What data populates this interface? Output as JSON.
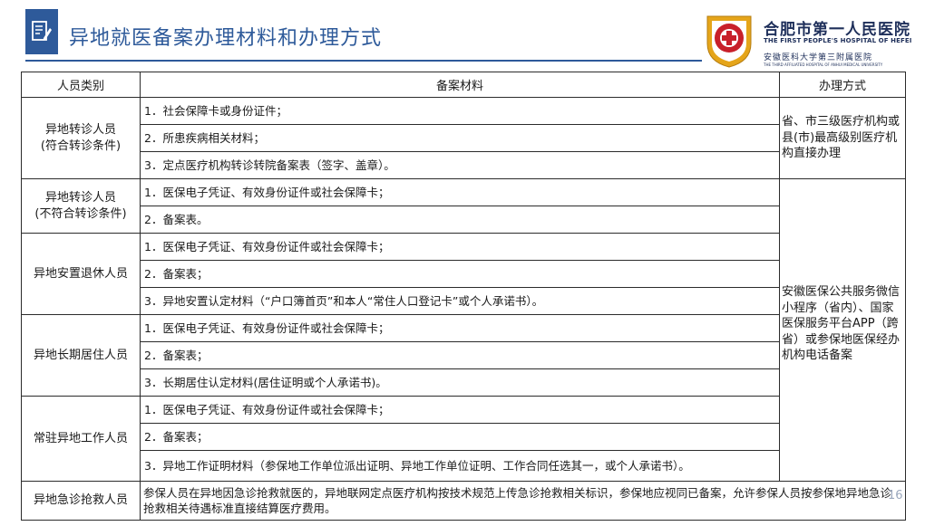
{
  "header": {
    "title": "异地就医备案办理材料和办理方式",
    "hospital_cn": "合肥市第一人民医院",
    "hospital_en": "THE FIRST PEOPLE'S HOSPITAL OF HEFEI",
    "hospital_sub_cn": "安徽医科大学第三附属医院",
    "hospital_sub_en": "THE THIRD AFFILIATED HOSPITAL OF ANHUI MEDICAL UNIVERSITY",
    "icon": "document-edit-icon"
  },
  "table": {
    "columns": [
      "人员类别",
      "备案材料",
      "办理方式"
    ],
    "groups": [
      {
        "category_lines": [
          "异地转诊人员",
          "(符合转诊条件)"
        ],
        "materials": [
          "1．社会保障卡或身份证件；",
          "2．所患疾病相关材料；",
          "3．定点医疗机构转诊转院备案表（签字、盖章）。"
        ]
      },
      {
        "category_lines": [
          "异地转诊人员",
          "(不符合转诊条件)"
        ],
        "materials": [
          "1．医保电子凭证、有效身份证件或社会保障卡；",
          "2．备案表。"
        ]
      },
      {
        "category_lines": [
          "异地安置退休人员"
        ],
        "materials": [
          "1．医保电子凭证、有效身份证件或社会保障卡；",
          "2．备案表；",
          "3．异地安置认定材料（“户口簿首页”和本人“常住人口登记卡”或个人承诺书）。"
        ]
      },
      {
        "category_lines": [
          "异地长期居住人员"
        ],
        "materials": [
          "1．医保电子凭证、有效身份证件或社会保障卡；",
          "2．备案表；",
          "3．长期居住认定材料(居住证明或个人承诺书)。"
        ]
      },
      {
        "category_lines": [
          "常驻异地工作人员"
        ],
        "materials": [
          "1．医保电子凭证、有效身份证件或社会保障卡；",
          "2．备案表；",
          "3．异地工作证明材料（参保地工作单位派出证明、异地工作单位证明、工作合同任选其一，或个人承诺书）。"
        ]
      }
    ],
    "methods": [
      "省、市三级医疗机构或县(市)最高级别医疗机构直接办理",
      "安徽医保公共服务微信小程序（省内）、国家医保服务平台APP（跨省）或参保地医保经办机构电话备案"
    ],
    "emergency": {
      "category": "异地急诊抢救人员",
      "text": "参保人员在异地因急诊抢救就医的，异地联网定点医疗机构按技术规范上传急诊抢救相关标识，参保地应视同已备案，允许参保人员按参保地异地急诊抢救相关待遇标准直接结算医疗费用。"
    }
  },
  "page_number": "16",
  "colors": {
    "accent": "#2e5a9a",
    "logo_gold": "#e5a51a",
    "logo_red": "#c8202a"
  }
}
